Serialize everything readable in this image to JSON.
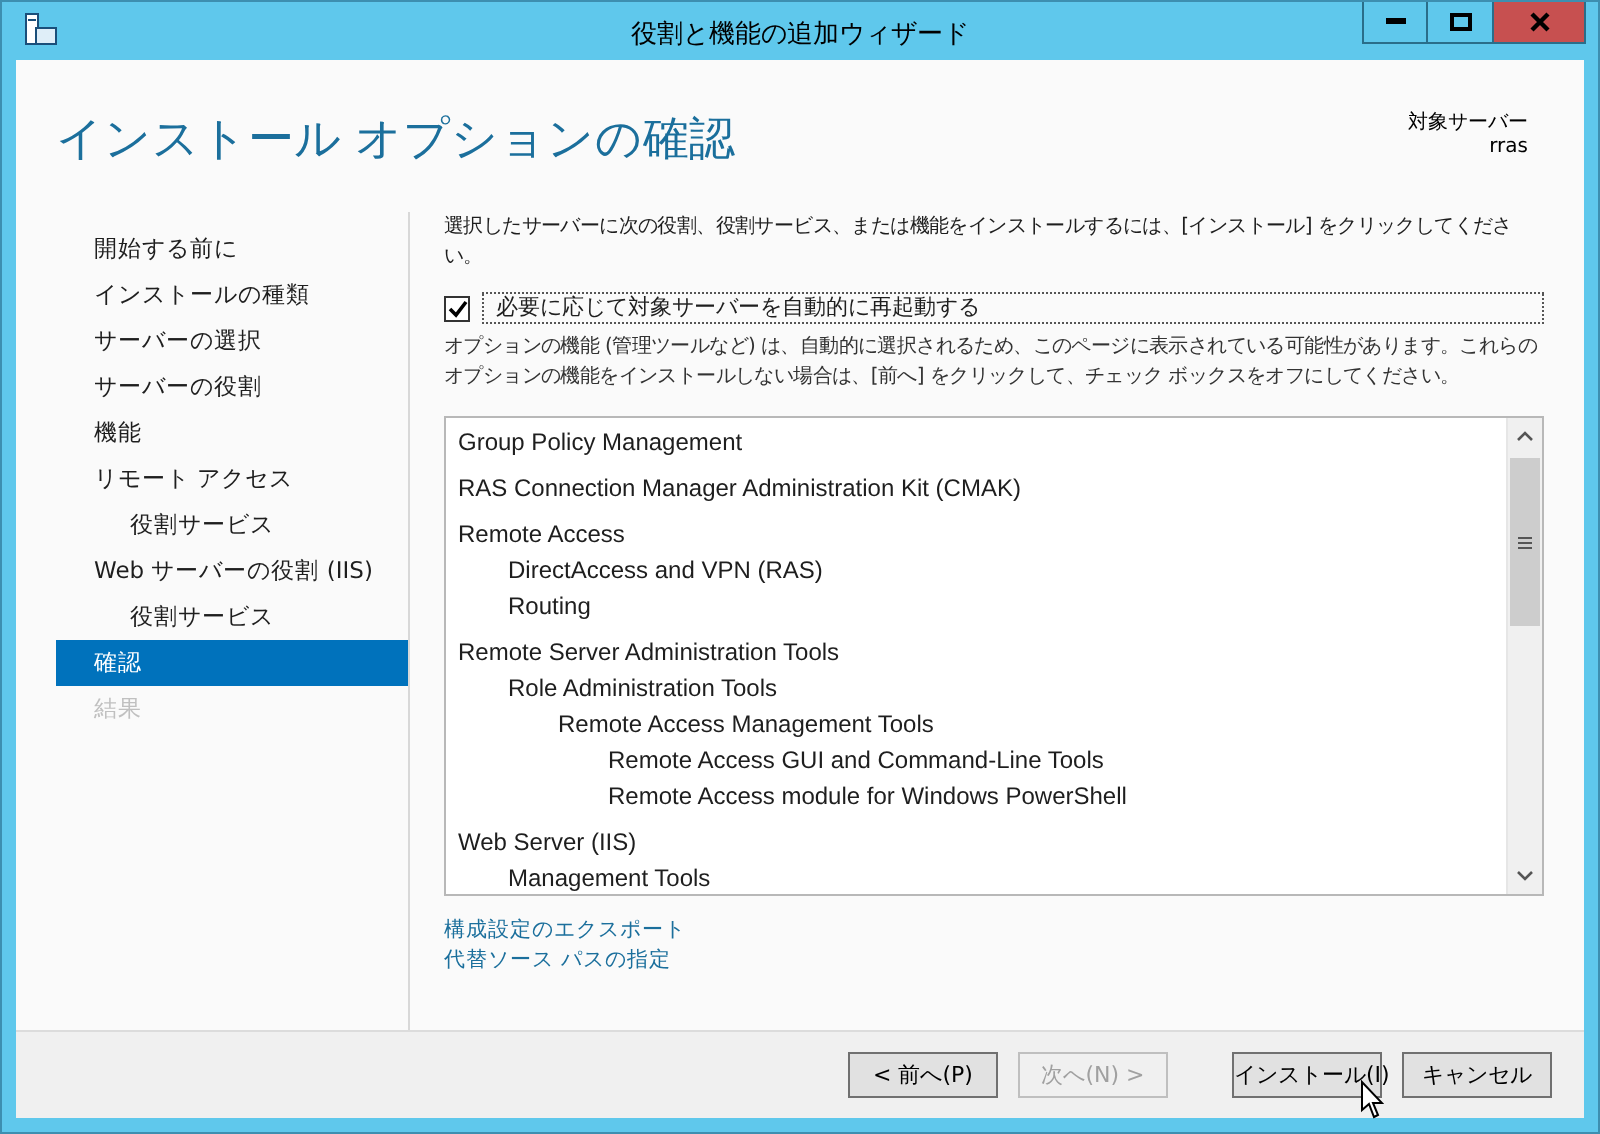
{
  "window": {
    "title": "役割と機能の追加ウィザード"
  },
  "header": {
    "title": "インストール オプションの確認",
    "target_label": "対象サーバー",
    "target_server": "rras"
  },
  "sidebar": {
    "items": [
      {
        "label": "開始する前に",
        "selected": false,
        "disabled": false
      },
      {
        "label": "インストールの種類",
        "selected": false,
        "disabled": false
      },
      {
        "label": "サーバーの選択",
        "selected": false,
        "disabled": false
      },
      {
        "label": "サーバーの役割",
        "selected": false,
        "disabled": false
      },
      {
        "label": "機能",
        "selected": false,
        "disabled": false
      },
      {
        "label": "リモート アクセス",
        "selected": false,
        "disabled": false,
        "children": [
          {
            "label": "役割サービス",
            "selected": false,
            "disabled": false
          }
        ]
      },
      {
        "label": "Web サーバーの役割 (IIS)",
        "selected": false,
        "disabled": false,
        "children": [
          {
            "label": "役割サービス",
            "selected": false,
            "disabled": false
          }
        ]
      },
      {
        "label": "確認",
        "selected": true,
        "disabled": false
      },
      {
        "label": "結果",
        "selected": false,
        "disabled": true
      }
    ]
  },
  "intro": "選択したサーバーに次の役割、役割サービス、または機能をインストールするには、[インストール] をクリックしてください。",
  "restart_checkbox": {
    "label": "必要に応じて対象サーバーを自動的に再起動する",
    "checked": true
  },
  "note": "オプションの機能 (管理ツールなど) は、自動的に選択されるため、このページに表示されている可能性があります。これらのオプションの機能をインストールしない場合は、[前へ] をクリックして、チェック ボックスをオフにしてください。",
  "features": [
    {
      "label": "Group Policy Management"
    },
    {
      "label": "RAS Connection Manager Administration Kit (CMAK)"
    },
    {
      "label": "Remote Access",
      "children": [
        {
          "label": "DirectAccess and VPN (RAS)"
        },
        {
          "label": "Routing"
        }
      ]
    },
    {
      "label": "Remote Server Administration Tools",
      "children": [
        {
          "label": "Role Administration Tools",
          "children": [
            {
              "label": "Remote Access Management Tools",
              "children": [
                {
                  "label": "Remote Access GUI and Command-Line Tools"
                },
                {
                  "label": "Remote Access module for Windows PowerShell"
                }
              ]
            }
          ]
        }
      ]
    },
    {
      "label": "Web Server (IIS)",
      "children": [
        {
          "label": "Management Tools"
        }
      ]
    }
  ],
  "links": [
    "構成設定のエクスポート",
    "代替ソース パスの指定"
  ],
  "buttons": [
    {
      "label": "< 前へ(P)",
      "disabled": false
    },
    {
      "label": "次へ(N) >",
      "disabled": true
    },
    {
      "label": "インストール(I)",
      "disabled": false
    },
    {
      "label": "キャンセル",
      "disabled": false
    }
  ]
}
